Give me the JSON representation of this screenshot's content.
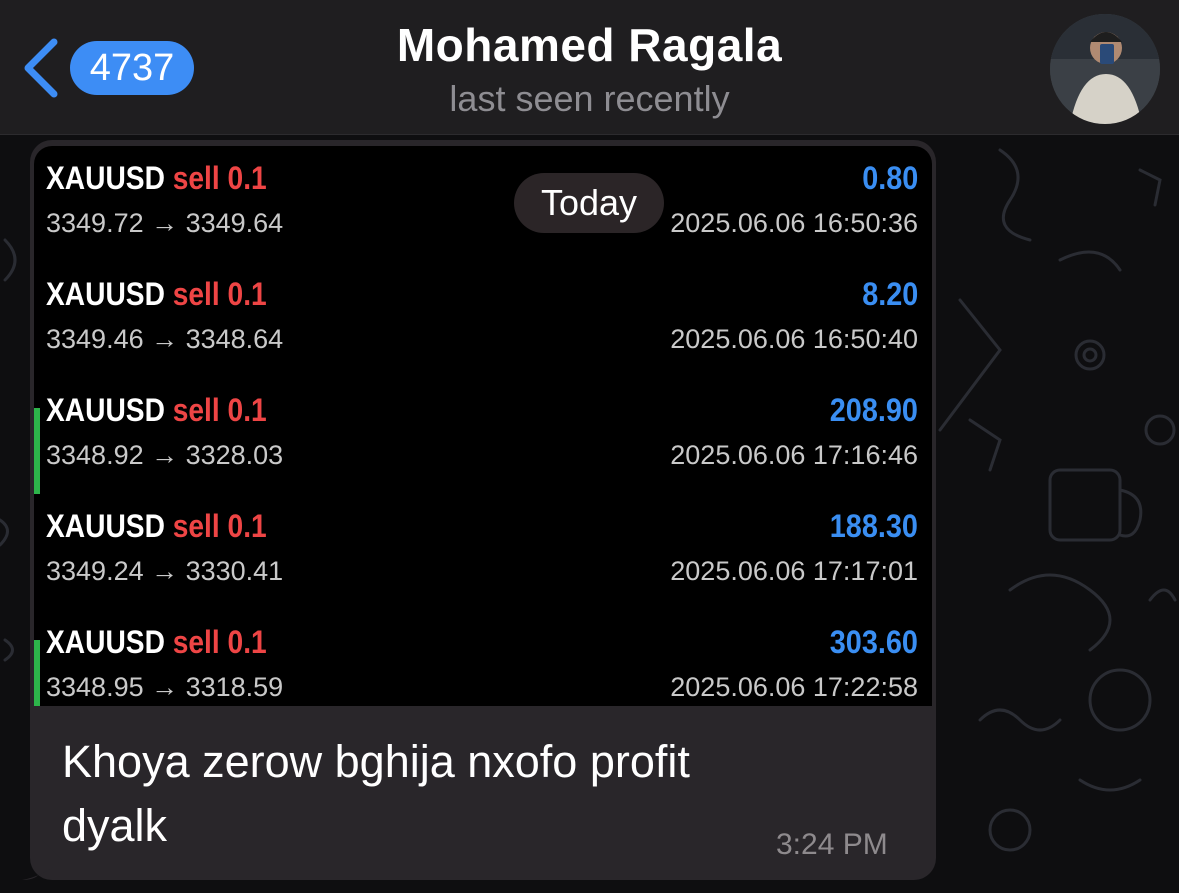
{
  "header": {
    "back_badge": "4737",
    "title": "Mohamed Ragala",
    "subtitle": "last seen recently"
  },
  "date_pill": "Today",
  "trades": [
    {
      "symbol": "XAUUSD",
      "side": "sell 0.1",
      "prices": "3349.72 → 3349.64",
      "profit": "0.80",
      "time": "2025.06.06 16:50:36",
      "marked": false
    },
    {
      "symbol": "XAUUSD",
      "side": "sell 0.1",
      "prices": "3349.46 → 3348.64",
      "profit": "8.20",
      "time": "2025.06.06 16:50:40",
      "marked": false
    },
    {
      "symbol": "XAUUSD",
      "side": "sell 0.1",
      "prices": "3348.92 → 3328.03",
      "profit": "208.90",
      "time": "2025.06.06 17:16:46",
      "marked": true
    },
    {
      "symbol": "XAUUSD",
      "side": "sell 0.1",
      "prices": "3349.24 → 3330.41",
      "profit": "188.30",
      "time": "2025.06.06 17:17:01",
      "marked": false
    },
    {
      "symbol": "XAUUSD",
      "side": "sell 0.1",
      "prices": "3348.95 → 3318.59",
      "profit": "303.60",
      "time": "2025.06.06 17:22:58",
      "marked": true
    }
  ],
  "message": {
    "text_line1": "Khoya zerow bghija nxofo profit",
    "text_line2": "dyalk",
    "time": "3:24 PM"
  },
  "colors": {
    "accent_blue": "#3d8df5",
    "profit_blue": "#3a8ef2",
    "sell_red": "#ee4545",
    "marker_green": "#2db44a",
    "bubble_bg": "#29262a"
  }
}
